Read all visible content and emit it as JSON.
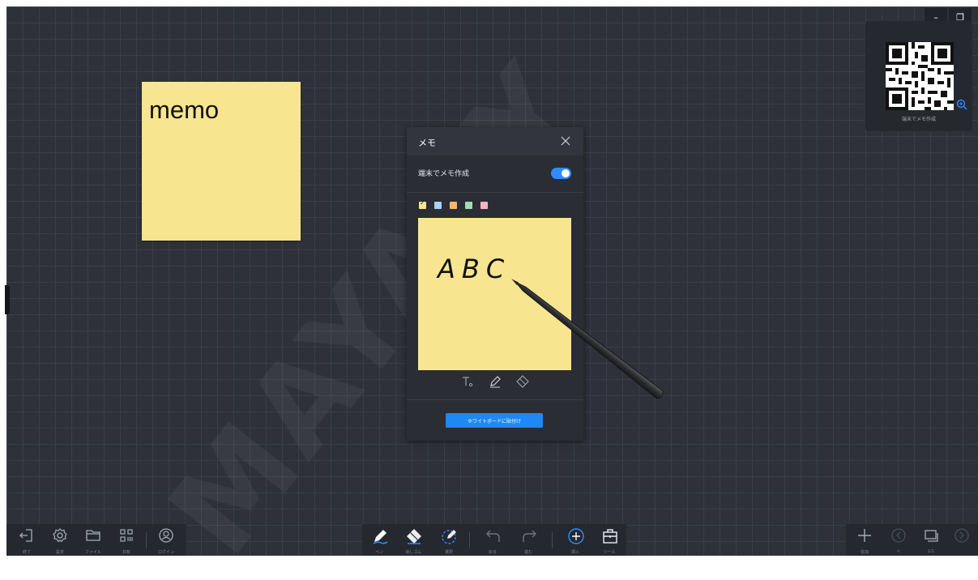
{
  "window_controls": {
    "minimize": "–",
    "restore": "❐"
  },
  "qr_widget": {
    "label": "端末でメモ作成"
  },
  "memo_note": {
    "text": "memo"
  },
  "watermark": "MAYASY",
  "panel": {
    "title": "メモ",
    "toggle_label": "端末でメモ作成",
    "toggle_on": true,
    "colors": [
      "#f8e58f",
      "#a9d1f0",
      "#f5b66a",
      "#9fdcb4",
      "#f5b3c0"
    ],
    "handwriting": "ABC",
    "paste_button": "ホワイトボードに貼付け"
  },
  "toolbar_left": [
    {
      "label": "終了",
      "icon": "exit-icon"
    },
    {
      "label": "設定",
      "icon": "gear-icon"
    },
    {
      "label": "ファイル",
      "icon": "folder-icon"
    },
    {
      "label": "共有",
      "icon": "qr-grid-icon"
    },
    {
      "label": "ログイン",
      "icon": "user-icon"
    }
  ],
  "toolbar_center": [
    {
      "label": "ペン",
      "icon": "pen-icon"
    },
    {
      "label": "消しゴム",
      "icon": "eraser-icon"
    },
    {
      "label": "選択",
      "icon": "lasso-icon"
    },
    {
      "label": "戻る",
      "icon": "undo-icon"
    },
    {
      "label": "進む",
      "icon": "redo-icon"
    },
    {
      "label": "挿入",
      "icon": "plus-circle-icon"
    },
    {
      "label": "ツール",
      "icon": "toolbox-icon"
    }
  ],
  "toolbar_right": [
    {
      "label": "追加",
      "icon": "plus-icon"
    },
    {
      "label": "<",
      "icon": "prev-icon"
    },
    {
      "label": "1/1",
      "icon": "pages-icon"
    },
    {
      "label": "",
      "icon": "next-icon"
    }
  ]
}
